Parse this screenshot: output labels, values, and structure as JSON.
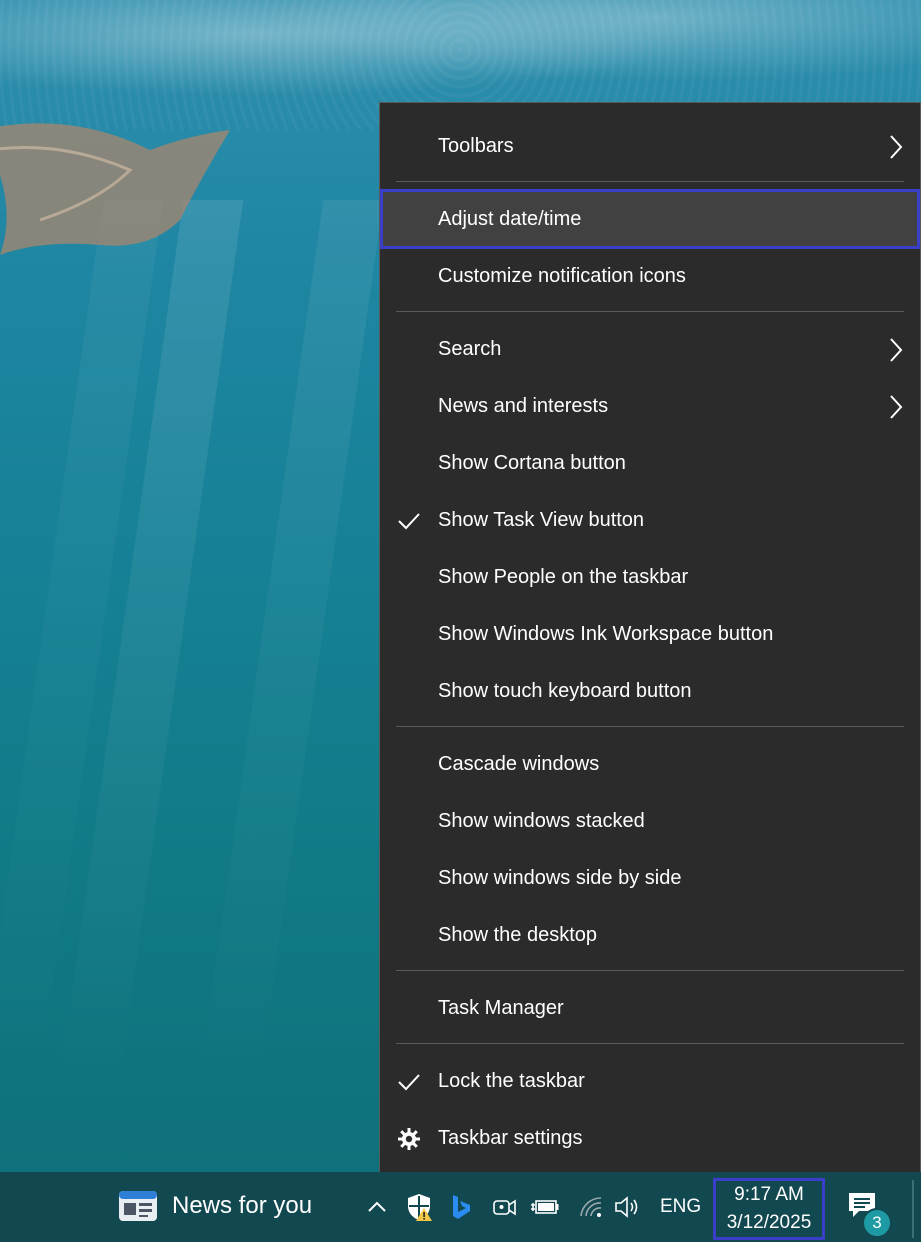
{
  "context_menu": {
    "toolbars": "Toolbars",
    "adjust_datetime": "Adjust date/time",
    "customize_notification_icons": "Customize notification icons",
    "search": "Search",
    "news_and_interests": "News and interests",
    "show_cortana": "Show Cortana button",
    "show_task_view": "Show Task View button",
    "show_people": "Show People on the taskbar",
    "show_ink_workspace": "Show Windows Ink Workspace button",
    "show_touch_keyboard": "Show touch keyboard button",
    "cascade_windows": "Cascade windows",
    "show_windows_stacked": "Show windows stacked",
    "show_side_by_side": "Show windows side by side",
    "show_desktop": "Show the desktop",
    "task_manager": "Task Manager",
    "lock_taskbar": "Lock the taskbar",
    "taskbar_settings": "Taskbar settings"
  },
  "checked": {
    "show_task_view": true,
    "lock_taskbar": true
  },
  "taskbar": {
    "news_label": "News for you",
    "language": "ENG",
    "time": "9:17 AM",
    "date": "3/12/2025",
    "notification_count": "3"
  },
  "colors": {
    "menu_bg": "#2b2b2b",
    "menu_highlight": "#414141",
    "focus_outline": "#3b3fc8",
    "taskbar_bg": "#124850",
    "badge": "#1e9aa4"
  },
  "icons": [
    "chevron-right-icon",
    "checkmark-icon",
    "gear-icon",
    "news-widget-icon",
    "chevron-up-icon",
    "security-shield-icon",
    "bing-icon",
    "meet-now-icon",
    "battery-icon",
    "wifi-icon",
    "volume-icon",
    "notification-icon"
  ]
}
